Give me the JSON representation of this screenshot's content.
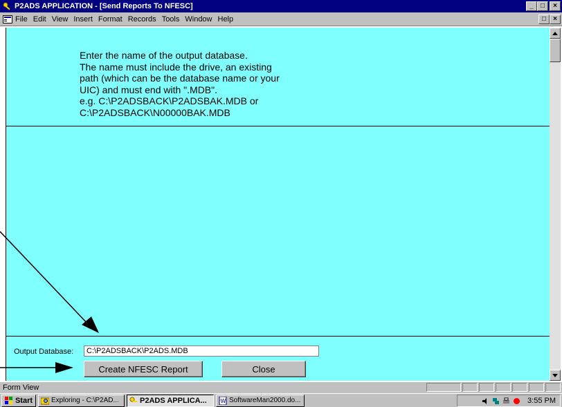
{
  "window": {
    "title": "P2ADS APPLICATION - [Send Reports To NFESC]",
    "buttons": {
      "minimize": "_",
      "maximize": "□",
      "close": "×"
    }
  },
  "menu": {
    "items": [
      {
        "label": "File"
      },
      {
        "label": "Edit"
      },
      {
        "label": "View"
      },
      {
        "label": "Insert"
      },
      {
        "label": "Format"
      },
      {
        "label": "Records"
      },
      {
        "label": "Tools"
      },
      {
        "label": "Window"
      },
      {
        "label": "Help"
      }
    ],
    "mdi_buttons": {
      "restore": "□",
      "close": "×"
    }
  },
  "form": {
    "instructions": [
      "Enter the name of the output database.",
      "The name must include the drive, an existing",
      "path (which can be the database name or your",
      "UIC) and must end with \".MDB\".",
      "e.g.  C:\\P2ADSBACK\\P2ADSBAK.MDB or",
      "C:\\P2ADSBACK\\N00000BAK.MDB"
    ],
    "output_label": "Output Database:",
    "output_value": "C:\\P2ADSBACK\\P2ADS.MDB",
    "create_button": "Create NFESC Report",
    "close_button": "Close",
    "background": "#80ffff"
  },
  "status": {
    "text": "Form View"
  },
  "taskbar": {
    "start": "Start",
    "tasks": [
      {
        "label": "Exploring - C:\\P2AD...",
        "icon": "explorer-icon"
      },
      {
        "label": "P2ADS APPLICA...",
        "icon": "access-app-icon",
        "active": true
      },
      {
        "label": "SoftwareMan2000.do...",
        "icon": "word-doc-icon"
      }
    ],
    "clock": "3:55 PM"
  },
  "colors": {
    "title_bar": "#000080",
    "chrome": "#c0c0c0",
    "form_background": "#80ffff"
  }
}
